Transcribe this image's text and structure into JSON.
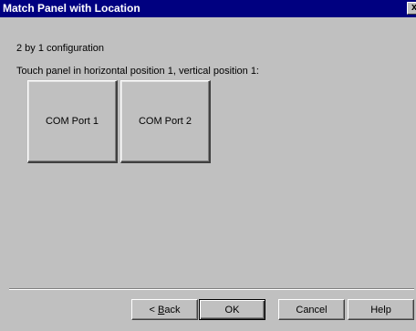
{
  "window": {
    "title": "Match Panel with Location",
    "close_glyph": "x"
  },
  "content": {
    "configuration_text": "2 by 1 configuration",
    "instruction_text": "Touch panel in horizontal position 1, vertical position 1:"
  },
  "ports": [
    {
      "label": "COM Port 1"
    },
    {
      "label": "COM Port 2"
    }
  ],
  "buttons": {
    "back_prefix": "< ",
    "back_mnemonic": "B",
    "back_suffix": "ack",
    "ok_label": "OK",
    "cancel_label": "Cancel",
    "help_label": "Help"
  },
  "icons": {
    "close": "close-icon"
  },
  "colors": {
    "titlebar": "#000080",
    "face": "#c0c0c0"
  }
}
